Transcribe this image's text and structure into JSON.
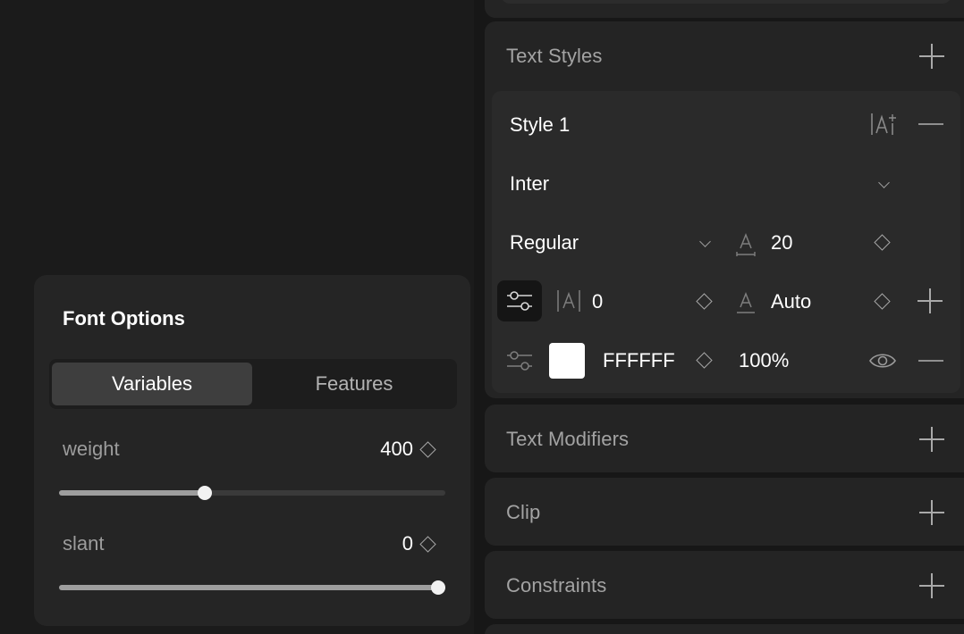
{
  "inspector": {
    "text_styles": {
      "title": "Text Styles"
    },
    "style": {
      "name": "Style 1",
      "font_family": "Inter",
      "font_weight": "Regular",
      "font_size": "20",
      "letter_spacing": "0",
      "line_height": "Auto",
      "color_hex": "FFFFFF",
      "opacity": "100%"
    },
    "sections": {
      "text_modifiers": "Text Modifiers",
      "clip": "Clip",
      "constraints": "Constraints"
    }
  },
  "font_options": {
    "title": "Font Options",
    "tabs": {
      "variables": "Variables",
      "features": "Features",
      "active": "Variables"
    },
    "variables": [
      {
        "label": "weight",
        "value": "400",
        "fraction": 0.377
      },
      {
        "label": "slant",
        "value": "0",
        "fraction": 1.0
      }
    ]
  },
  "icons": {
    "add": "plus-icon",
    "remove": "minus-icon",
    "keyframe": "diamond-icon",
    "dropdown": "chevron-down-icon",
    "font_settings": "text-settings-icon",
    "font_size": "font-size-icon",
    "letter_spacing": "letter-spacing-icon",
    "line_height": "line-height-icon",
    "tuner": "sliders-icon",
    "visibility": "eye-icon"
  },
  "colors": {
    "background": "#1b1b1b",
    "panel": "#242424",
    "card": "#2a2a2a",
    "accent_text": "#ffffff",
    "swatch": "#FFFFFF"
  }
}
